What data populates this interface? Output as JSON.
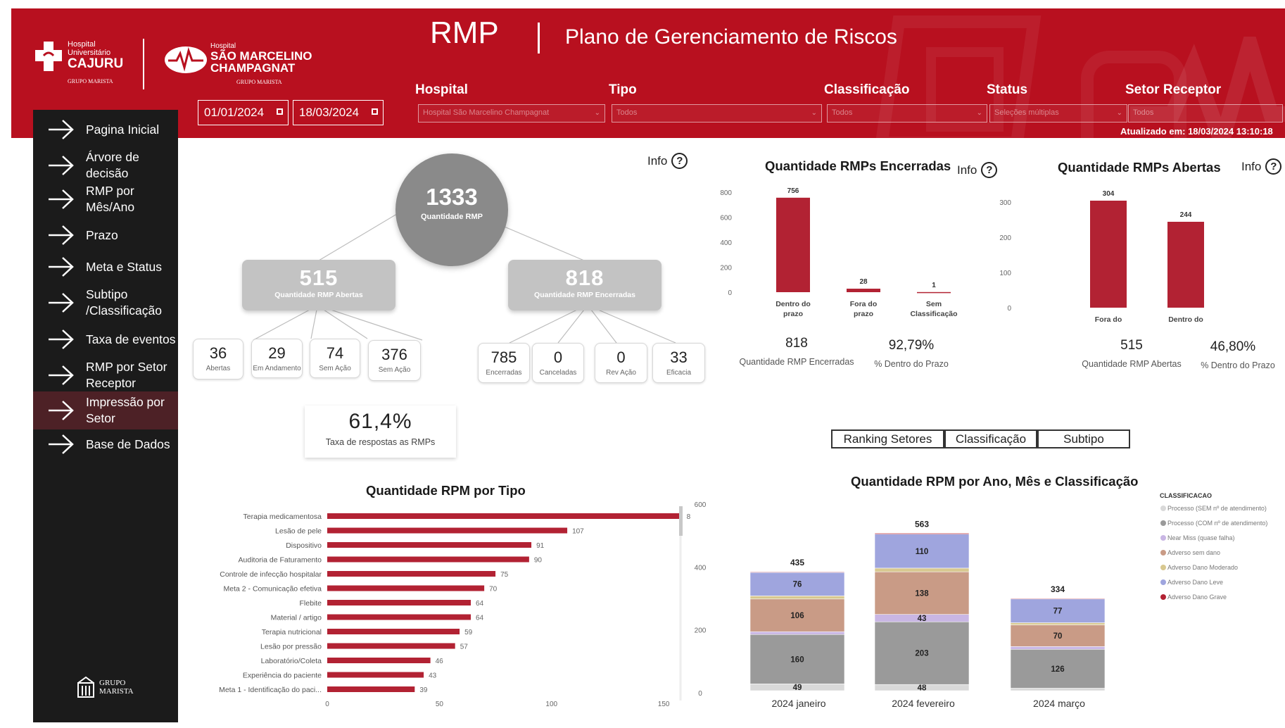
{
  "header": {
    "title": "RMP",
    "subtitle": "Plano de Gerenciamento de Riscos",
    "updated": "Atualizado em: 18/03/2024 13:10:18",
    "logo1": {
      "line1": "Hospital",
      "line2": "Universitário",
      "line3": "CAJURU",
      "line4": "GRUPO MARISTA"
    },
    "logo2": {
      "line1": "Hospital",
      "line2": "SÃO MARCELINO",
      "line3": "CHAMPAGNAT",
      "line4": "GRUPO MARISTA"
    },
    "colors": {
      "brand": "#b8101f",
      "dark": "#1b1b1b"
    }
  },
  "filters": {
    "date_start": "01/01/2024",
    "date_end": "18/03/2024",
    "hospital": {
      "label": "Hospital",
      "value": "Hospital São Marcelino Champagnat"
    },
    "tipo": {
      "label": "Tipo",
      "value": "Todos"
    },
    "classificacao": {
      "label": "Classificação",
      "value": "Todos"
    },
    "status": {
      "label": "Status",
      "value": "Seleções múltiplas"
    },
    "setor": {
      "label": "Setor Receptor",
      "value": "Todos"
    }
  },
  "sidebar": {
    "items": [
      {
        "label1": "Pagina Inicial",
        "label2": ""
      },
      {
        "label1": "Árvore de",
        "label2": "decisão"
      },
      {
        "label1": "RMP por",
        "label2": "Mês/Ano"
      },
      {
        "label1": "Prazo",
        "label2": ""
      },
      {
        "label1": "Meta e Status",
        "label2": ""
      },
      {
        "label1": "Subtipo",
        "label2": "/Classificação"
      },
      {
        "label1": "Taxa de eventos",
        "label2": ""
      },
      {
        "label1": "RMP por Setor",
        "label2": "Receptor"
      },
      {
        "label1": "Impressão por",
        "label2": "Setor"
      },
      {
        "label1": "Base de Dados",
        "label2": ""
      }
    ],
    "footer_logo": {
      "line1": "GRUPO",
      "line2": "MARISTA"
    }
  },
  "tree": {
    "info": "Info",
    "root": {
      "value": "1333",
      "label": "Quantidade RMP"
    },
    "left": {
      "value": "515",
      "label": "Quantidade RMP Abertas"
    },
    "right": {
      "value": "818",
      "label": "Quantidade RMP Encerradas"
    },
    "left_leaves": [
      {
        "value": "36",
        "label": "Abertas"
      },
      {
        "value": "29",
        "label": "Em Andamento"
      },
      {
        "value": "74",
        "label": "Sem Ação"
      },
      {
        "value": "376",
        "label": "Sem Ação"
      }
    ],
    "right_leaves": [
      {
        "value": "785",
        "label": "Encerradas"
      },
      {
        "value": "0",
        "label": "Canceladas"
      },
      {
        "value": "0",
        "label": "Rev Ação"
      },
      {
        "value": "33",
        "label": "Eficacia"
      }
    ],
    "rate": {
      "value": "61,4%",
      "label": "Taxa de respostas as RMPs"
    }
  },
  "encerradas": {
    "title": "Quantidade RMPs Encerradas",
    "info": "Info",
    "kpi1": {
      "value": "818",
      "label": "Quantidade RMP Encerradas"
    },
    "kpi2": {
      "value": "92,79%",
      "label": "% Dentro do Prazo"
    }
  },
  "abertas": {
    "title": "Quantidade RMPs Abertas",
    "info": "Info",
    "kpi1": {
      "value": "515",
      "label": "Quantidade RMP Abertas"
    },
    "kpi2": {
      "value": "46,80%",
      "label": "% Dentro do Prazo"
    }
  },
  "tabs": [
    "Ranking Setores",
    "Classificação",
    "Subtipo"
  ],
  "chart_data": [
    {
      "id": "encerradas",
      "type": "bar",
      "title": "Quantidade RMPs Encerradas",
      "categories": [
        "Dentro do prazo",
        "Fora do prazo",
        "Sem Classificação"
      ],
      "values": [
        756,
        28,
        1
      ],
      "ylim": [
        0,
        800
      ],
      "yticks": [
        0,
        200,
        400,
        600,
        800
      ],
      "color": "#b22233"
    },
    {
      "id": "abertas",
      "type": "bar",
      "title": "Quantidade RMPs Abertas",
      "categories": [
        "Fora do prazo",
        "Dentro do prazo"
      ],
      "values": [
        304,
        244
      ],
      "ylim": [
        0,
        300
      ],
      "yticks": [
        0,
        100,
        200,
        300
      ],
      "color": "#b22233"
    },
    {
      "id": "tipo",
      "type": "bar",
      "orientation": "horizontal",
      "title": "Quantidade RPM por Tipo",
      "categories": [
        "Terapia medicamentosa",
        "Lesão de pele",
        "Dispositivo",
        "Auditoria de Faturamento",
        "Controle de infecção hospitalar",
        "Meta 2 - Comunicação efetiva",
        "Flebite",
        "Material / artigo",
        "Terapia nutricional",
        "Lesão por pressão",
        "Laboratório/Coleta",
        "Experiência do paciente",
        "Meta 1 - Identificação do paci..."
      ],
      "values": [
        158,
        107,
        91,
        90,
        75,
        70,
        64,
        64,
        59,
        57,
        46,
        43,
        39
      ],
      "value_labels": [
        "8",
        "107",
        "91",
        "90",
        "75",
        "70",
        "64",
        "64",
        "59",
        "57",
        "46",
        "43",
        "39"
      ],
      "xlim": [
        0,
        160
      ],
      "xticks": [
        0,
        50,
        100,
        150
      ],
      "second_axis_ticks": [
        0,
        200,
        400,
        600
      ],
      "color": "#b22233"
    },
    {
      "id": "classificacao",
      "type": "bar",
      "stacked": true,
      "title": "Quantidade RPM por Ano, Mês e Classificação",
      "legend_title": "CLASSIFICACAO",
      "categories": [
        "2024 janeiro",
        "2024 fevereiro",
        "2024 março"
      ],
      "totals": [
        435,
        563,
        334
      ],
      "series": [
        {
          "name": "Processo (SEM nº de atendimento)",
          "color": "#d9d9d9",
          "values": [
            22,
            20,
            8
          ]
        },
        {
          "name": "Processo (COM nº de atendimento)",
          "color": "#9a9a9a",
          "values": [
            160,
            203,
            126
          ]
        },
        {
          "name": "Near Miss (quase falha)",
          "color": "#c9b6e4",
          "values": [
            9,
            24,
            9
          ]
        },
        {
          "name": "Adverso sem dano",
          "color": "#c99b86",
          "values": [
            106,
            138,
            70
          ]
        },
        {
          "name": "Adverso Dano Moderado",
          "color": "#d8c890",
          "values": [
            10,
            12,
            7
          ]
        },
        {
          "name": "Adverso Dano Leve",
          "color": "#9fa5de",
          "values": [
            76,
            110,
            77
          ]
        },
        {
          "name": "Adverso Dano Grave",
          "color": "#b22233",
          "values": [
            2,
            3,
            2
          ]
        }
      ],
      "segment_labels": [
        [
          49,
          160,
          null,
          106,
          null,
          76,
          null
        ],
        [
          48,
          203,
          43,
          138,
          null,
          110,
          null
        ],
        [
          null,
          126,
          null,
          70,
          null,
          77,
          null
        ]
      ],
      "ylim": [
        0,
        600
      ]
    }
  ]
}
